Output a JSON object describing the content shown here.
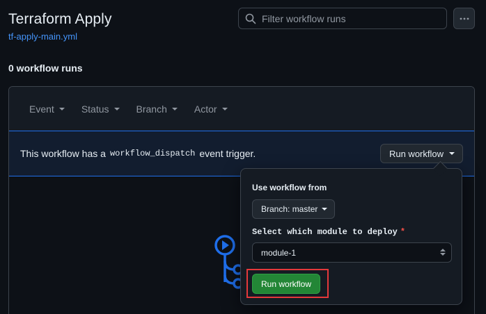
{
  "header": {
    "title": "Terraform Apply",
    "workflow_file": "tf-apply-main.yml",
    "search_placeholder": "Filter workflow runs",
    "more_menu_icon": "kebab-horizontal-icon"
  },
  "runs": {
    "count_label": "0 workflow runs"
  },
  "filters": [
    {
      "label": "Event"
    },
    {
      "label": "Status"
    },
    {
      "label": "Branch"
    },
    {
      "label": "Actor"
    }
  ],
  "dispatch": {
    "text_before": "This workflow has a",
    "code": "workflow_dispatch",
    "text_after": "event trigger.",
    "run_button_label": "Run workflow"
  },
  "dropdown": {
    "use_from_label": "Use workflow from",
    "branch_button_label": "Branch: master",
    "module_label": "Select which module to deploy",
    "required_marker": "*",
    "module_selected": "module-1",
    "submit_label": "Run workflow"
  },
  "colors": {
    "background": "#0d1117",
    "link": "#4493f8",
    "accent_blue": "#1f6feb",
    "success_green": "#238636",
    "highlight_red": "#e5383b"
  }
}
